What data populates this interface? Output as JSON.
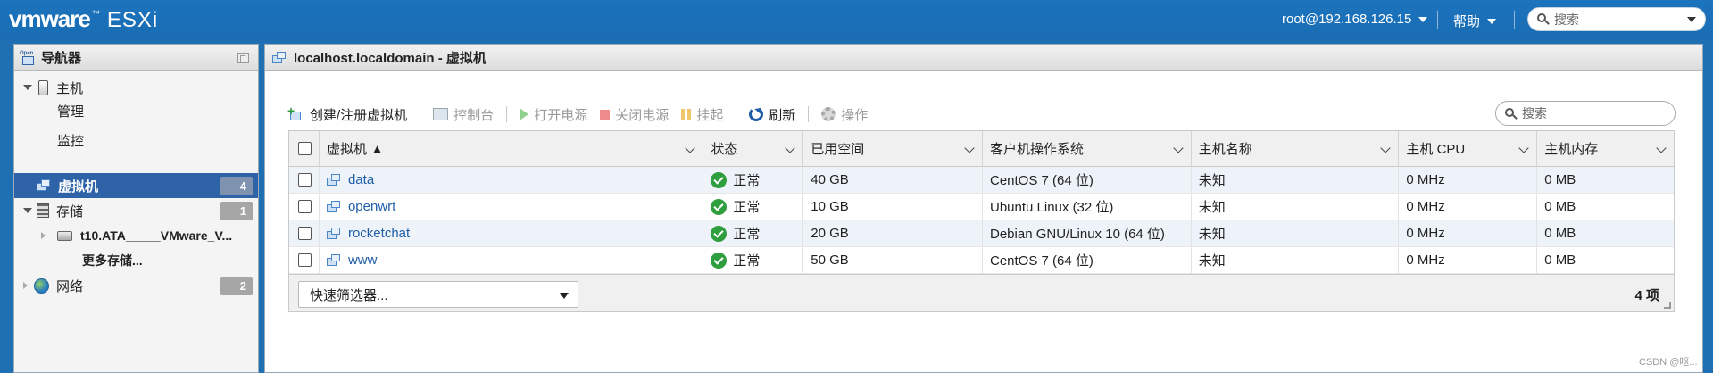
{
  "header": {
    "logo_brand": "vmware",
    "logo_product": "ESXi",
    "logo_mark": "™",
    "user": "root@192.168.126.15",
    "help": "帮助",
    "search_placeholder": "搜索"
  },
  "navigator": {
    "title": "导航器",
    "host": "主机",
    "manage": "管理",
    "monitor": "监控",
    "vms": "虚拟机",
    "vms_count": "4",
    "storage": "存储",
    "storage_count": "1",
    "datastore": "t10.ATA_____VMware_V...",
    "more_storage": "更多存储...",
    "network": "网络",
    "network_count": "2"
  },
  "main": {
    "title": "localhost.localdomain - 虚拟机",
    "search_placeholder": "搜索",
    "toolbar": {
      "create": "创建/注册虚拟机",
      "console": "控制台",
      "power_on": "打开电源",
      "power_off": "关闭电源",
      "suspend": "挂起",
      "refresh": "刷新",
      "actions": "操作"
    },
    "columns": [
      "虚拟机 ▲",
      "状态",
      "已用空间",
      "客户机操作系统",
      "主机名称",
      "主机 CPU",
      "主机内存"
    ],
    "rows": [
      {
        "name": "data",
        "status": "正常",
        "space": "40 GB",
        "os": "CentOS 7 (64 位)",
        "hostname": "未知",
        "cpu": "0 MHz",
        "mem": "0 MB"
      },
      {
        "name": "openwrt",
        "status": "正常",
        "space": "10 GB",
        "os": "Ubuntu Linux (32 位)",
        "hostname": "未知",
        "cpu": "0 MHz",
        "mem": "0 MB"
      },
      {
        "name": "rocketchat",
        "status": "正常",
        "space": "20 GB",
        "os": "Debian GNU/Linux 10 (64 位)",
        "hostname": "未知",
        "cpu": "0 MHz",
        "mem": "0 MB"
      },
      {
        "name": "www",
        "status": "正常",
        "space": "50 GB",
        "os": "CentOS 7 (64 位)",
        "hostname": "未知",
        "cpu": "0 MHz",
        "mem": "0 MB"
      }
    ],
    "quick_filter": "快速筛选器...",
    "item_count": "4 项"
  },
  "watermark": "CSDN @呕..."
}
